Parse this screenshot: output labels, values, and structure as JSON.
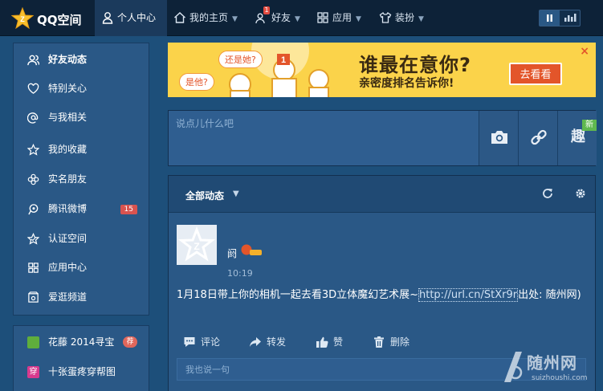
{
  "header": {
    "logo_text": "QQ空间",
    "nav": [
      {
        "label": "个人中心"
      },
      {
        "label": "我的主页"
      },
      {
        "label": "好友",
        "badge": "1"
      },
      {
        "label": "应用"
      },
      {
        "label": "装扮"
      }
    ]
  },
  "sidebar": {
    "items": [
      {
        "label": "好友动态",
        "icon": "friends-icon"
      },
      {
        "label": "特别关心",
        "icon": "heart-icon"
      },
      {
        "label": "与我相关",
        "icon": "at-icon"
      },
      {
        "label": "我的收藏",
        "icon": "star-icon"
      },
      {
        "label": "实名朋友",
        "icon": "flower-icon"
      },
      {
        "label": "腾讯微博",
        "icon": "weibo-icon",
        "count": "15"
      },
      {
        "label": "认证空间",
        "icon": "certified-icon"
      },
      {
        "label": "应用中心",
        "icon": "apps-icon"
      },
      {
        "label": "爱逛频道",
        "icon": "shop-icon"
      }
    ],
    "apps": [
      {
        "label": "花藤 2014寻宝",
        "tag": "荐",
        "color": "#5fae3c"
      },
      {
        "label": "十张蛋疼穿帮图",
        "tag": "",
        "color": "#d83a8e"
      }
    ]
  },
  "banner": {
    "bubble1": "还是她?",
    "bubble2": "是他?",
    "headline": "谁最在意你?",
    "sub": "亲密度排名告诉你!",
    "button": "去看看",
    "close": "×"
  },
  "composer": {
    "placeholder": "说点儿什么吧",
    "new_tag": "新",
    "fun_glyph": "趣"
  },
  "feed": {
    "title": "全部动态",
    "post": {
      "user": "阏",
      "time": "10:19",
      "text_before": "1月18日带上你的相机一起去看3D立体魔幻艺术展~",
      "link": "http://url.cn/StXr9r",
      "text_after": "出处: 随州网)"
    },
    "actions": {
      "comment": "评论",
      "forward": "转发",
      "like": "赞",
      "delete": "删除"
    },
    "comment_placeholder": "我也说一句"
  },
  "watermark": {
    "main": "随州网",
    "sub": "suizhoushi.com"
  },
  "colors": {
    "nav_bg": "#0d2238",
    "panel_bg": "#2a5886",
    "banner_bg": "#fbd34a",
    "accent_orange": "#e3552a",
    "badge_red": "#d9534f"
  }
}
